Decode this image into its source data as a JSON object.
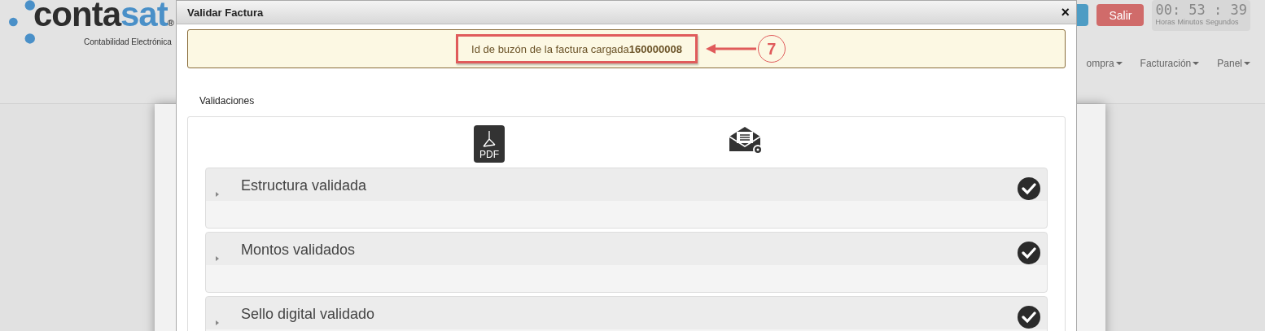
{
  "logo": {
    "name_dark": "conta",
    "name_accent": "sat",
    "registered": "®",
    "tagline": "Contabilidad Electrónica"
  },
  "header_buttons": [
    {
      "label": "Salir",
      "kind": "danger"
    }
  ],
  "clock": {
    "time": "00: 53 : 39",
    "units": [
      "Horas",
      "Minutos",
      "Segundos"
    ]
  },
  "nav": [
    {
      "label": "ompra"
    },
    {
      "label": "Facturación"
    },
    {
      "label": "Panel"
    }
  ],
  "modal": {
    "title": "Validar Factura",
    "close": "×",
    "alert": {
      "text": "Id de buzón de la factura cargada**160000008**",
      "callout": "7"
    },
    "tab": "Validaciones",
    "file_icon_label": "PDF",
    "validations": [
      {
        "title": "Estructura validada",
        "expanded": false,
        "validated": true
      },
      {
        "title": "Montos validados",
        "expanded": false,
        "validated": true
      },
      {
        "title": "Sello digital validado",
        "expanded": false,
        "validated": true
      }
    ]
  }
}
